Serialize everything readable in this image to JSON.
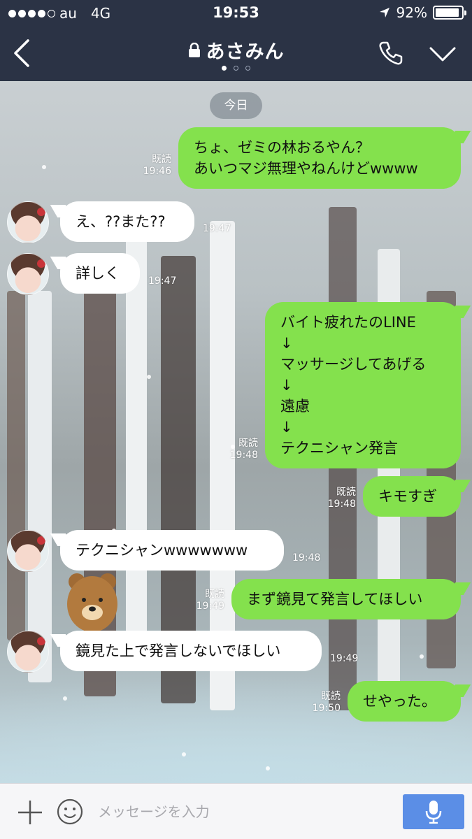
{
  "status_bar": {
    "carrier": "au",
    "network": "4G",
    "time": "19:53",
    "battery": "92%",
    "battery_level": 0.92
  },
  "header": {
    "title": "あさみん",
    "page_count": 3,
    "active_page": 1
  },
  "chat": {
    "date_label": "今日",
    "messages": [
      {
        "direction": "out",
        "text": "ちょ、ゼミの林おるやん？\nあいつマジ無理やねんけどwwww",
        "read": "既読",
        "time": "19:46"
      },
      {
        "direction": "in",
        "text": "え、??また??",
        "time": "19:47"
      },
      {
        "direction": "in",
        "text": "詳しく",
        "time": "19:47"
      },
      {
        "direction": "out",
        "text": "バイト疲れたのLINE\n↓\nマッサージしてあげる\n↓\n遠慮\n↓\nテクニシャン発言",
        "read": "既読",
        "time": "19:48"
      },
      {
        "direction": "out",
        "text": "キモすぎ",
        "read": "既読",
        "time": "19:48"
      },
      {
        "direction": "in",
        "text": "テクニシャンwwwwwww",
        "time": "19:48"
      },
      {
        "direction": "out",
        "text": "まず鏡見て発言してほしい",
        "read": "既読",
        "time": "19:49"
      },
      {
        "direction": "in",
        "text": "鏡見た上で発言しないでほしい",
        "time": "19:49"
      },
      {
        "direction": "out",
        "text": "せやった。",
        "read": "既読",
        "time": "19:50"
      }
    ]
  },
  "input_bar": {
    "placeholder": "メッセージを入力"
  },
  "colors": {
    "header_bg": "#2b3345",
    "outgoing_bubble": "#84e14d",
    "incoming_bubble": "#ffffff",
    "mic_button": "#5b8ee6"
  },
  "icons": {
    "back": "chevron-left-icon",
    "lock": "lock-icon",
    "phone": "phone-icon",
    "menu": "chevron-down-icon",
    "location": "location-arrow-icon",
    "plus": "plus-icon",
    "emoji": "smiley-icon",
    "mic": "microphone-icon"
  }
}
